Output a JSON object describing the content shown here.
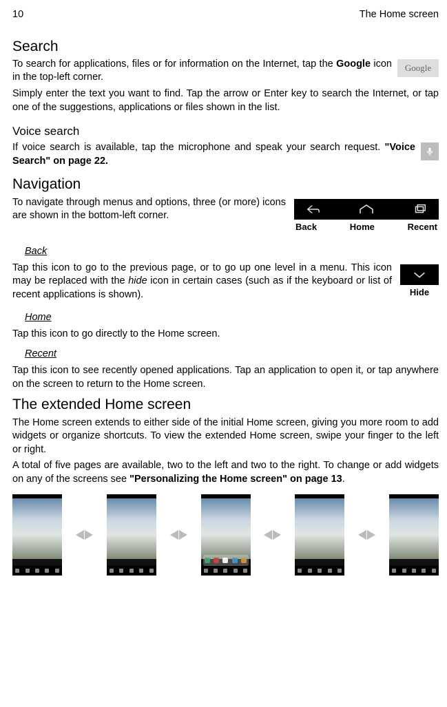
{
  "header": {
    "page_number": "10",
    "title": "The Home screen"
  },
  "search": {
    "heading": "Search",
    "p1a": "To search for applications, files or for information on the Internet, tap the ",
    "p1b_bold": "Google",
    "p1c": "  icon in the top-left corner.",
    "p2": "Simply enter the text you want to find. Tap the arrow or Enter key to search the Internet, or tap one of the suggestions, applications or files shown in the list.",
    "google_label": "Google"
  },
  "voice": {
    "heading": "Voice search",
    "p1a": "If voice search is available, tap the microphone and speak your search request. ",
    "p1b_bold": "\"Voice Search\" on page 22."
  },
  "navigation": {
    "heading": "Navigation",
    "p1": "To navigate through menus and options, three (or more) icons are shown in the bottom-left corner.",
    "labels": {
      "back": "Back",
      "home": "Home",
      "recent": "Recent"
    },
    "back": {
      "heading": "Back",
      "p_a": "Tap this icon to go to the previous page, or to go up one level in a menu. This icon may be replaced with the ",
      "p_i": "hide",
      "p_b": " icon in certain cases (such as if the keyboard or list of recent applications is shown).",
      "hide_label": "Hide"
    },
    "home": {
      "heading": "Home",
      "p": "Tap this icon to go directly to the Home screen."
    },
    "recent": {
      "heading": "Recent",
      "p": "Tap this icon to see recently opened applications. Tap an application to open it, or tap anywhere on the screen to return to the Home screen."
    }
  },
  "extended": {
    "heading": "The extended Home screen",
    "p1": "The Home screen extends to either side of the initial Home screen, giving you more room to add widgets or organize shortcuts. To view the extended Home screen, swipe your finger to the left or right.",
    "p2a": "A total of five pages are available, two to the left and two to the right. To change or add widgets on any of the screens see ",
    "p2b_bold": "\"Personalizing the Home screen\" on page 13",
    "p2c": "."
  }
}
